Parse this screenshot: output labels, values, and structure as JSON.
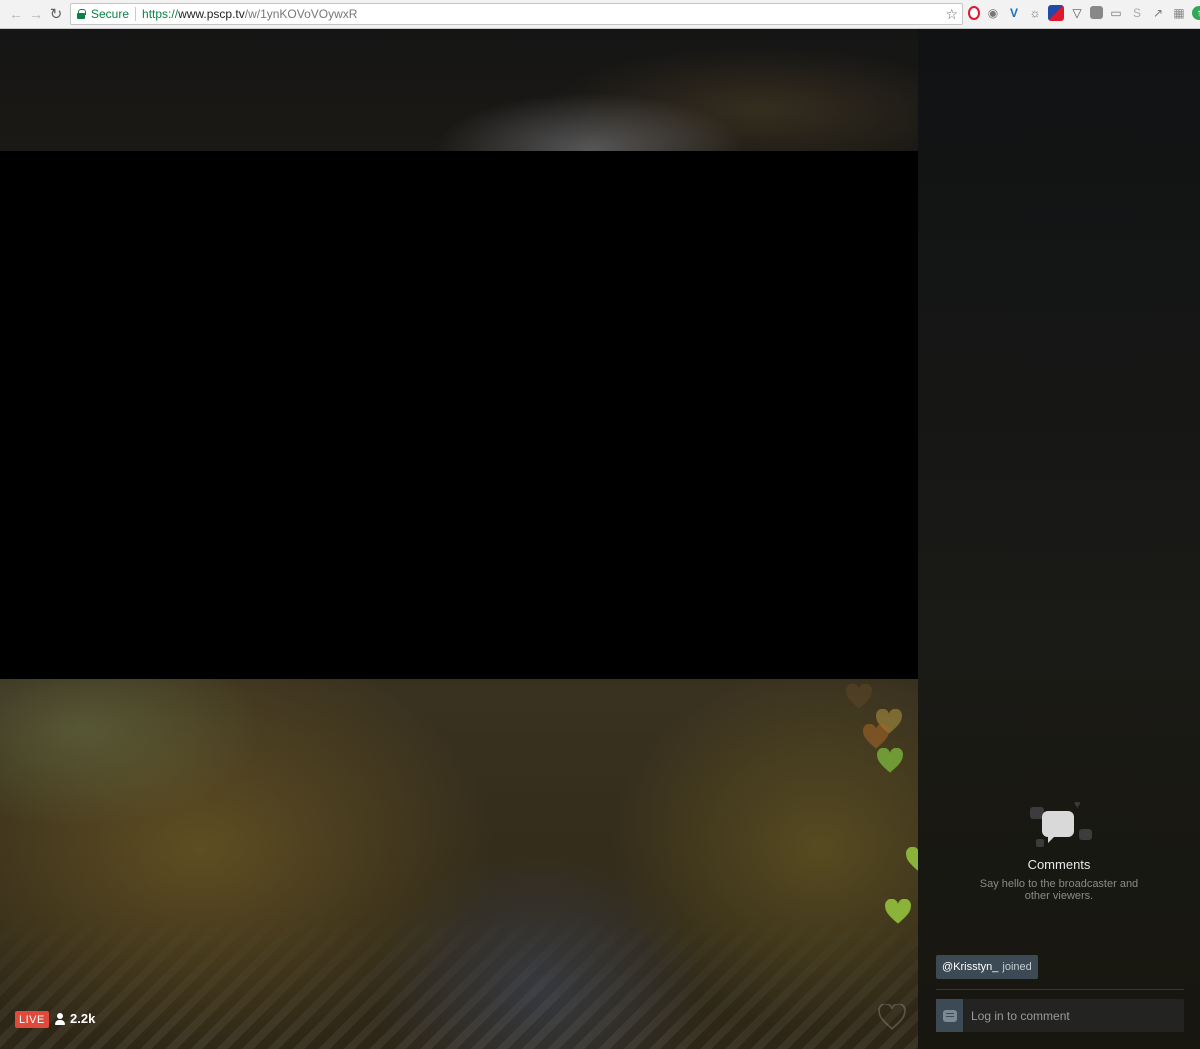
{
  "browser": {
    "secure_label": "Secure",
    "url_scheme": "https://",
    "url_host": "www.pscp.tv",
    "url_path": "/w/1ynKOVoVOywxR"
  },
  "player": {
    "live_label": "LIVE",
    "viewer_count": "2.2k"
  },
  "comments": {
    "title": "Comments",
    "subtitle": "Say hello to the broadcaster and other viewers.",
    "joined_user": "@Krisstyn_",
    "joined_text": "joined",
    "input_placeholder": "Log in to comment"
  },
  "colors": {
    "live": "#e04a3b",
    "heart_green": "#8bb339",
    "toast_bg": "#3b4a55"
  }
}
